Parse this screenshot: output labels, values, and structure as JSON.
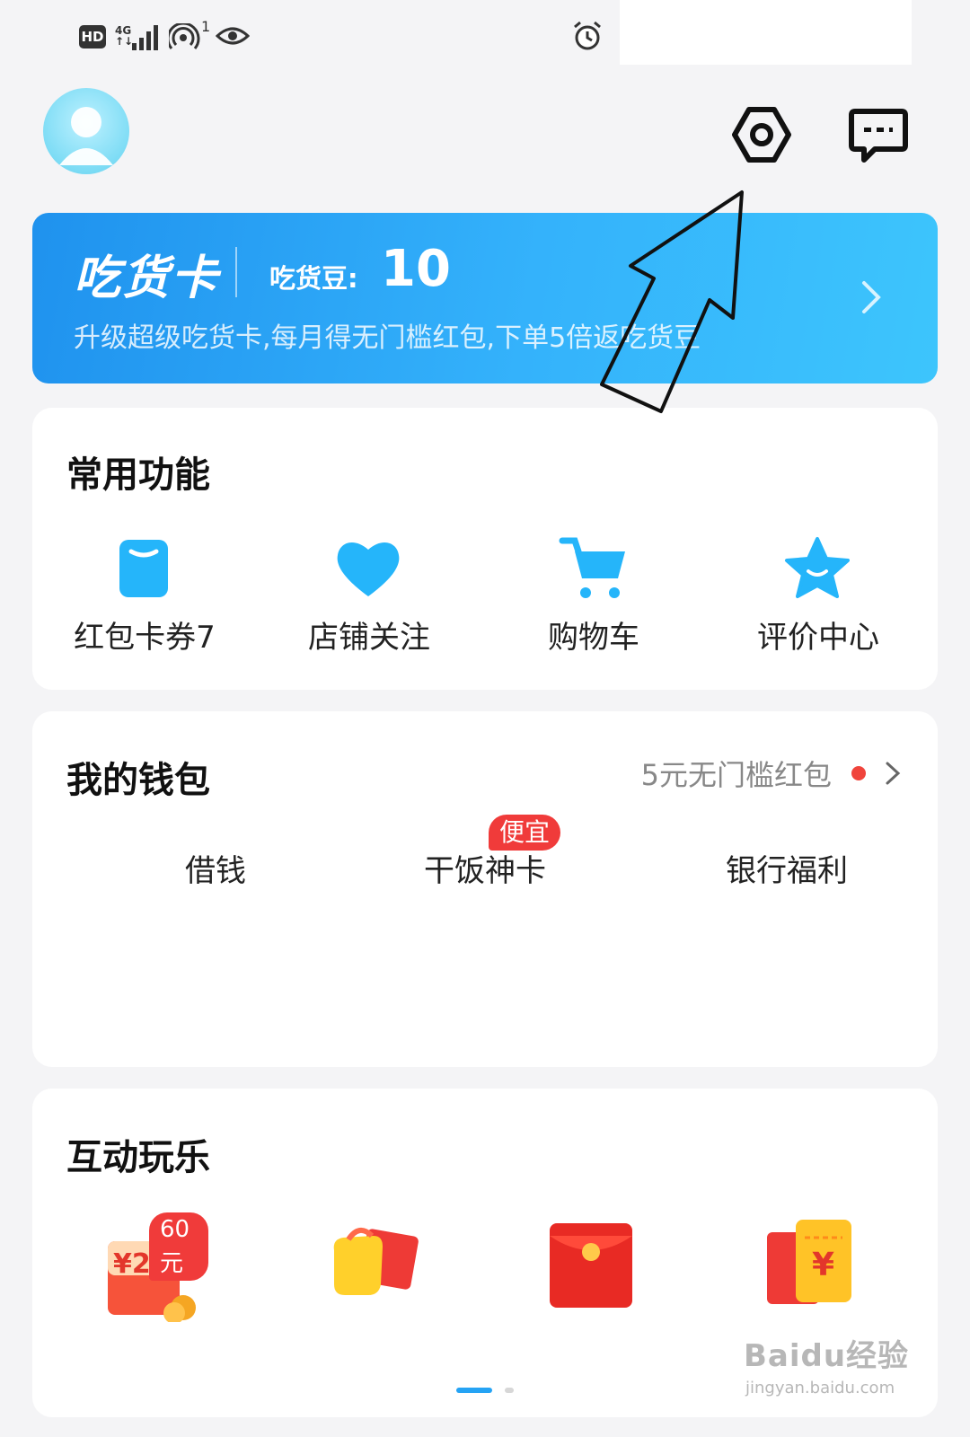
{
  "status_bar": {
    "hd": "HD",
    "network_top": "4G",
    "network_bottom": "↑↓",
    "hotspot_count": "1"
  },
  "header": {
    "avatar": "avatar",
    "settings_icon": "hexagon-settings-icon",
    "message_icon": "chat-bubble-icon"
  },
  "vip_card": {
    "title": "吃货卡",
    "beans_label": "吃货豆:",
    "beans_value": "10",
    "subtitle": "升级超级吃货卡,每月得无门槛红包,下单5倍返吃货豆"
  },
  "common_functions": {
    "title": "常用功能",
    "items": [
      {
        "label": "红包卡券7",
        "icon": "coupon-icon"
      },
      {
        "label": "店铺关注",
        "icon": "heart-icon"
      },
      {
        "label": "购物车",
        "icon": "cart-icon"
      },
      {
        "label": "评价中心",
        "icon": "star-icon"
      }
    ]
  },
  "wallet": {
    "title": "我的钱包",
    "link_text": "5元无门槛红包",
    "items": [
      {
        "label": "借钱"
      },
      {
        "label": "干饭神卡",
        "badge": "便宜"
      },
      {
        "label": "银行福利"
      }
    ]
  },
  "interactive": {
    "title": "互动玩乐",
    "games": [
      {
        "icon": "red-envelope-coins-icon",
        "badge": "60元",
        "amount": "¥20"
      },
      {
        "icon": "gift-box-icon"
      },
      {
        "icon": "red-packet-icon"
      },
      {
        "icon": "ticket-coupon-icon",
        "symbol": "¥"
      }
    ]
  },
  "watermark": {
    "main": "Baidu经验",
    "sub": "jingyan.baidu.com"
  },
  "colors": {
    "accent": "#25a3f4",
    "vip_gradient_start": "#1f92ee",
    "vip_gradient_end": "#3dc5fc",
    "badge_red": "#f03b3a"
  }
}
